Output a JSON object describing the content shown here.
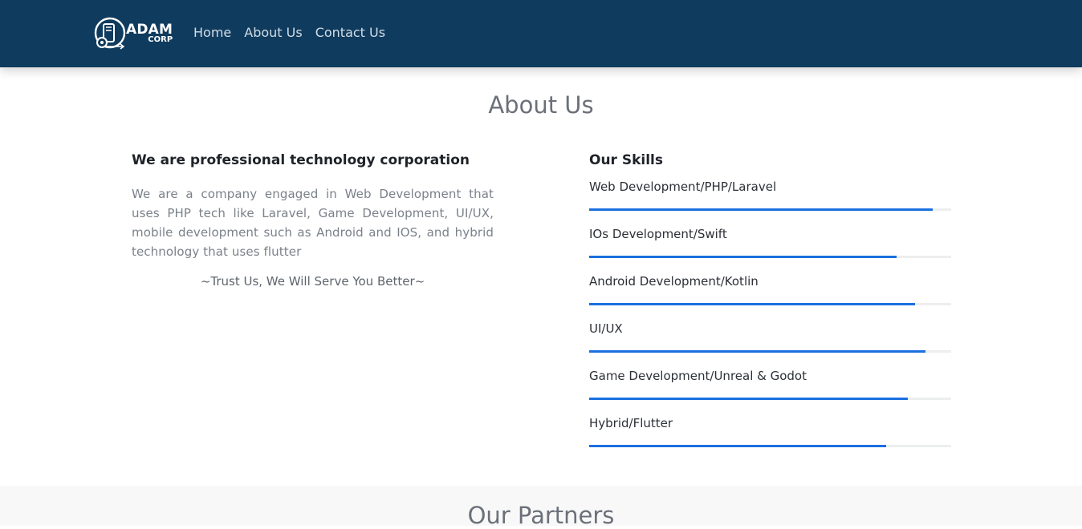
{
  "navbar": {
    "brand": {
      "name": "ADAM",
      "sub": "CORP"
    },
    "links": [
      {
        "label": "Home"
      },
      {
        "label": "About Us"
      },
      {
        "label": "Contact Us"
      }
    ]
  },
  "about": {
    "title": "About Us",
    "heading": "We are professional technology corporation",
    "paragraph": "We are a company engaged in Web Development that uses PHP tech like Laravel, Game Development, UI/UX, mobile development such as Android and IOS, and hybrid technology that uses flutter",
    "tagline": "~Trust Us, We Will Serve You Better~"
  },
  "skills": {
    "heading": "Our Skills",
    "items": [
      {
        "label": "Web Development/PHP/Laravel",
        "level": 95
      },
      {
        "label": "IOs Development/Swift",
        "level": 85
      },
      {
        "label": "Android Development/Kotlin",
        "level": 90
      },
      {
        "label": "UI/UX",
        "level": 93
      },
      {
        "label": "Game Development/Unreal & Godot",
        "level": 88
      },
      {
        "label": "Hybrid/Flutter",
        "level": 82
      }
    ]
  },
  "partners": {
    "title": "Our Partners"
  },
  "colors": {
    "navbar_bg": "#0f3b5e",
    "skill_bar": "#1a6fe0",
    "partners_bg": "#f8f8f8"
  },
  "icons": {
    "brand_logo": "gear-phone-logo-icon"
  }
}
